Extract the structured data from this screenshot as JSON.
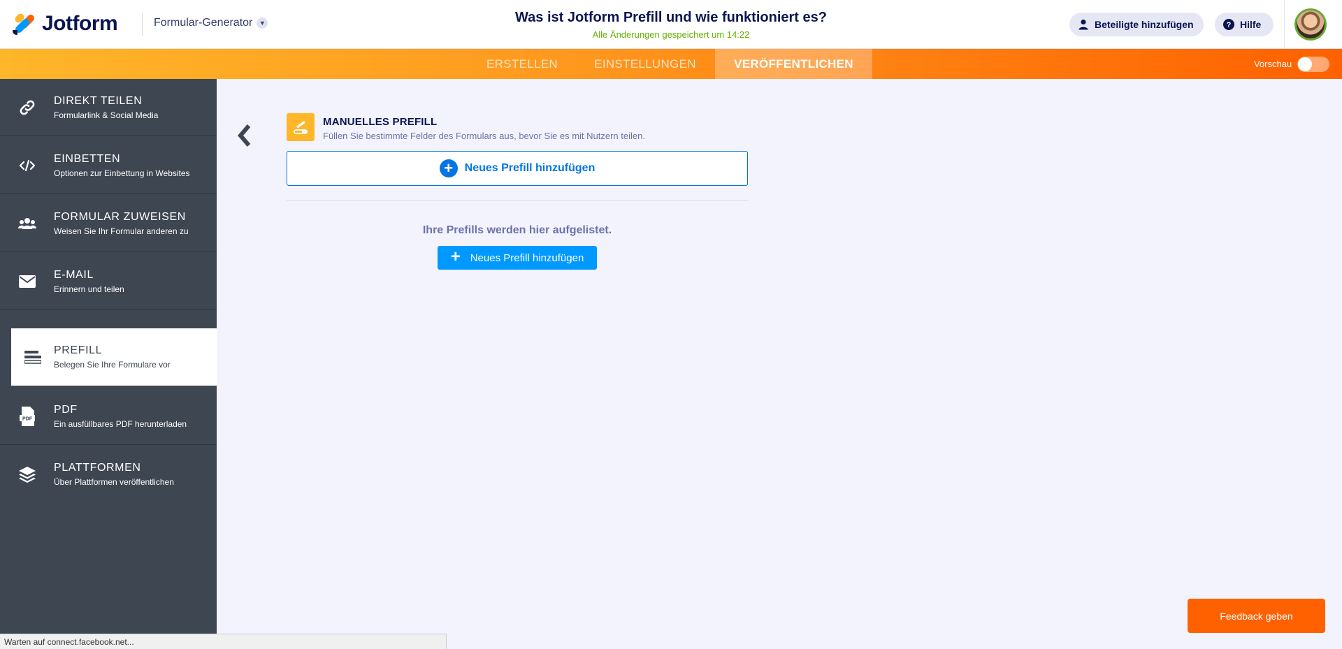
{
  "header": {
    "logo_text": "Jotform",
    "builder_label": "Formular-Generator",
    "form_title": "Was ist Jotform Prefill und wie funktioniert es?",
    "saved_status": "Alle Änderungen gespeichert um 14:22",
    "invite_label": "Beteiligte hinzufügen",
    "help_label": "Hilfe"
  },
  "navbar": {
    "tabs": [
      {
        "label": "ERSTELLEN"
      },
      {
        "label": "EINSTELLUNGEN"
      },
      {
        "label": "VERÖFFENTLICHEN"
      }
    ],
    "active_tab": "VERÖFFENTLICHEN",
    "preview_label": "Vorschau"
  },
  "sidebar": {
    "items": [
      {
        "title": "DIREKT TEILEN",
        "sub": "Formularlink & Social Media",
        "icon": "link-icon"
      },
      {
        "title": "EINBETTEN",
        "sub": "Optionen zur Einbettung in Websites",
        "icon": "code-icon"
      },
      {
        "title": "FORMULAR ZUWEISEN",
        "sub": "Weisen Sie Ihr Formular anderen zu",
        "icon": "users-icon"
      },
      {
        "title": "E-MAIL",
        "sub": "Erinnern und teilen",
        "icon": "envelope-icon"
      },
      {
        "title": "PREFILL",
        "sub": "Belegen Sie Ihre Formulare vor",
        "icon": "prefill-icon"
      },
      {
        "title": "PDF",
        "sub": "Ein ausfüllbares PDF herunterladen",
        "icon": "pdf-icon"
      },
      {
        "title": "PLATTFORMEN",
        "sub": "Über Plattformen veröffentlichen",
        "icon": "layers-icon"
      }
    ],
    "active_item": "PREFILL"
  },
  "main": {
    "panel_title": "MANUELLES PREFILL",
    "panel_sub": "Füllen Sie bestimmte Felder des Formulars aus, bevor Sie es mit Nutzern teilen.",
    "add_outline_label": "Neues Prefill hinzufügen",
    "empty_message": "Ihre Prefills werden hier aufgelistet.",
    "add_solid_label": "Neues Prefill hinzufügen"
  },
  "feedback_label": "Feedback geben",
  "statusbar_text": "Warten auf connect.facebook.net...",
  "colors": {
    "brand_orange": "#ff6100",
    "brand_yellow": "#ffb629",
    "primary_blue": "#0099ff",
    "sidebar_bg": "#3e4652",
    "saved_green": "#64b200"
  }
}
